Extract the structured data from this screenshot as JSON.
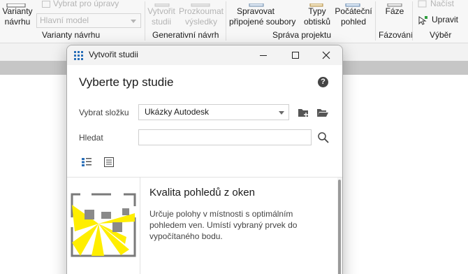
{
  "ribbon": {
    "variants_button": {
      "line1": "Varianty",
      "line2": "návrhu"
    },
    "select_for_edit": "Vybrat pro úpravy",
    "main_model": "Hlavní model",
    "variants_group": "Varianty návrhu",
    "create_study": {
      "line1": "Vytvořit",
      "line2": "studii"
    },
    "explore_results": {
      "line1": "Prozkoumat",
      "line2": "výsledky"
    },
    "generative_group": "Generativní návrh",
    "manage_links": {
      "line1": "Spravovat",
      "line2": "připojené soubory"
    },
    "hatch_types": {
      "line1": "Typy",
      "line2": "obtisků"
    },
    "starting_view": {
      "line1": "Počáteční",
      "line2": "pohled"
    },
    "project_group": "Správa projektu",
    "phases": {
      "label": "Fáze"
    },
    "phasing_group": "Fázování",
    "load": "Načíst",
    "edit": "Upravit",
    "selection_group": "Výběr"
  },
  "dialog": {
    "title": "Vytvořit studii",
    "heading": "Vyberte typ studie",
    "folder_label": "Vybrat složku",
    "folder_value": "Ukázky Autodesk",
    "search_label": "Hledat",
    "search_value": "",
    "help": "?",
    "study": {
      "title": "Kvalita pohledů z oken",
      "description": "Určuje polohy v místnosti s optimálním pohledem ven. Umístí vybraný prvek do vypočítaného bodu."
    }
  },
  "colors": {
    "accent_yellow": "#ffee00",
    "icon_blue": "#2a6fb8",
    "icon_green": "#2e9e3e"
  }
}
